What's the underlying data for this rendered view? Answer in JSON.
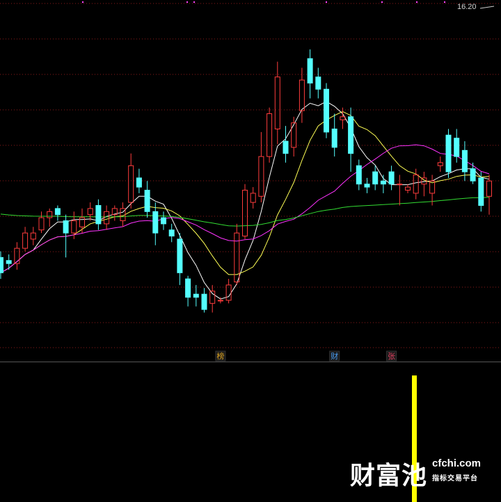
{
  "price_label": "16.20",
  "badges": [
    {
      "label": "榜",
      "color": "#d8a020",
      "index": 27
    },
    {
      "label": "财",
      "color": "#4a9cf0",
      "index": 41
    },
    {
      "label": "张",
      "color": "#e04060",
      "index": 48
    }
  ],
  "watermark": {
    "logo": "财富池",
    "site": "cfchi.com",
    "sub": "指标交易平台"
  },
  "colors": {
    "up": "#ff3c3c",
    "down": "#54ffff",
    "ma_white": "#ffffff",
    "ma_yellow": "#ffff55",
    "ma_magenta": "#ff33ff",
    "ma_green": "#33dd33",
    "grid": "#8b1a1a",
    "signal": "#ffff00"
  },
  "chart_data": {
    "type": "candlestick",
    "y_top_label": 16.2,
    "candles": [
      [
        8.0,
        7.5,
        8.2,
        7.3
      ],
      [
        7.9,
        7.8,
        8.1,
        7.6
      ],
      [
        7.8,
        8.3,
        8.5,
        7.6
      ],
      [
        8.3,
        8.8,
        9.0,
        8.2
      ],
      [
        8.6,
        8.8,
        9.0,
        8.4
      ],
      [
        8.9,
        9.3,
        9.5,
        8.8
      ],
      [
        9.3,
        9.5,
        9.6,
        9.0
      ],
      [
        9.6,
        9.4,
        9.7,
        9.2
      ],
      [
        9.2,
        8.8,
        9.4,
        8.0
      ],
      [
        8.8,
        9.2,
        9.5,
        8.6
      ],
      [
        9.0,
        9.3,
        9.6,
        8.8
      ],
      [
        9.4,
        9.6,
        9.8,
        9.2
      ],
      [
        9.7,
        9.1,
        9.9,
        8.9
      ],
      [
        9.1,
        9.5,
        9.7,
        8.9
      ],
      [
        9.4,
        9.6,
        9.7,
        9.2
      ],
      [
        9.2,
        9.6,
        9.8,
        9.0
      ],
      [
        9.8,
        11.0,
        11.4,
        9.6
      ],
      [
        10.6,
        10.3,
        10.9,
        10.1
      ],
      [
        10.2,
        9.5,
        10.5,
        9.3
      ],
      [
        9.5,
        8.8,
        9.8,
        8.4
      ],
      [
        9.3,
        9.1,
        9.5,
        8.9
      ],
      [
        8.9,
        8.7,
        9.1,
        8.5
      ],
      [
        8.6,
        7.5,
        8.8,
        7.1
      ],
      [
        7.3,
        6.7,
        7.4,
        6.4
      ],
      [
        6.8,
        6.7,
        7.1,
        6.4
      ],
      [
        6.8,
        6.3,
        7.0,
        6.2
      ],
      [
        6.5,
        6.9,
        7.1,
        6.2
      ],
      [
        6.6,
        6.6,
        6.7,
        6.5
      ],
      [
        6.6,
        7.1,
        7.3,
        6.5
      ],
      [
        7.2,
        8.8,
        9.1,
        7.1
      ],
      [
        8.7,
        10.2,
        10.4,
        8.6
      ],
      [
        9.8,
        10.1,
        10.3,
        9.6
      ],
      [
        10.0,
        11.3,
        12.1,
        9.8
      ],
      [
        11.3,
        12.7,
        12.9,
        11.1
      ],
      [
        12.2,
        13.9,
        14.4,
        11.7
      ],
      [
        11.8,
        11.4,
        12.3,
        11.1
      ],
      [
        11.6,
        12.4,
        12.6,
        11.3
      ],
      [
        12.8,
        13.8,
        14.2,
        12.4
      ],
      [
        14.5,
        13.7,
        14.8,
        13.2
      ],
      [
        13.9,
        13.5,
        14.2,
        13.2
      ],
      [
        13.5,
        12.1,
        13.7,
        11.9
      ],
      [
        12.2,
        11.6,
        12.7,
        11.3
      ],
      [
        12.5,
        12.6,
        12.9,
        12.2
      ],
      [
        12.6,
        11.4,
        12.9,
        10.8
      ],
      [
        11.0,
        10.4,
        11.2,
        10.2
      ],
      [
        10.4,
        10.3,
        10.6,
        10.1
      ],
      [
        10.8,
        10.4,
        11.0,
        10.2
      ],
      [
        10.5,
        10.4,
        10.7,
        10.1
      ],
      [
        10.8,
        10.4,
        11.0,
        10.2
      ],
      [
        10.4,
        10.4,
        10.7,
        9.7
      ],
      [
        10.2,
        10.3,
        10.4,
        10.1
      ],
      [
        10.1,
        10.7,
        10.9,
        9.9
      ],
      [
        10.4,
        10.6,
        10.8,
        10.0
      ],
      [
        10.1,
        10.5,
        10.7,
        9.7
      ],
      [
        11.0,
        11.1,
        11.3,
        10.8
      ],
      [
        12.0,
        10.8,
        12.2,
        10.6
      ],
      [
        11.9,
        11.3,
        12.2,
        11.1
      ],
      [
        11.5,
        10.8,
        11.8,
        10.5
      ],
      [
        10.9,
        10.5,
        11.1,
        10.4
      ],
      [
        10.6,
        9.7,
        10.8,
        9.5
      ],
      [
        10.0,
        10.5,
        10.7,
        9.4
      ]
    ]
  }
}
